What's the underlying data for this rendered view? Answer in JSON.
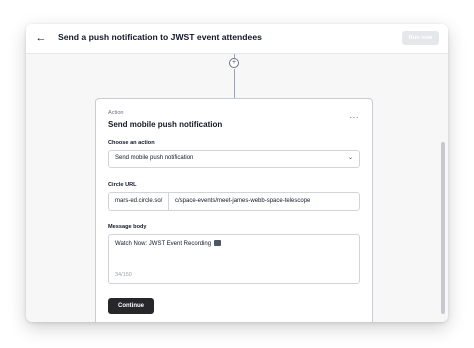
{
  "header": {
    "back_icon": "arrow-left-icon",
    "title": "Send a push notification to JWST event attendees",
    "run_label": "Run now"
  },
  "card": {
    "label": "Action",
    "heading": "Send mobile push notification",
    "menu_icon": "ellipsis-icon"
  },
  "form": {
    "action": {
      "label": "Choose an action",
      "value": "Send mobile push notification"
    },
    "url": {
      "label": "Circle URL",
      "prefix": "mars-ed.circle.so/",
      "value": "c/space-events/meet-james-webb-space-telescope"
    },
    "message": {
      "label": "Message body",
      "value": "Watch Now: JWST Event Recording",
      "count": "34/150"
    }
  },
  "continue_label": "Continue",
  "colors": {
    "primary": "#27272a",
    "disabled": "#e5e7eb",
    "border": "#d1d5db"
  }
}
